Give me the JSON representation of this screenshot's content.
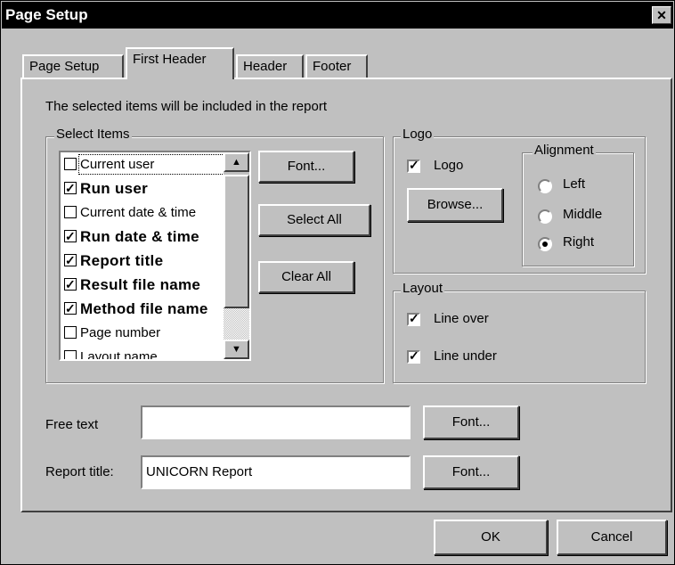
{
  "window": {
    "title": "Page Setup"
  },
  "tabs": [
    {
      "label": "Page Setup"
    },
    {
      "label": "First Header"
    },
    {
      "label": "Header"
    },
    {
      "label": "Footer"
    }
  ],
  "panel": {
    "intro_text": "The selected items will be included in the report",
    "select_items": {
      "group_label": "Select Items",
      "items": [
        {
          "label": "Current user",
          "checked": false,
          "bold": false
        },
        {
          "label": "Run user",
          "checked": true,
          "bold": true
        },
        {
          "label": "Current date & time",
          "checked": false,
          "bold": false
        },
        {
          "label": "Run date & time",
          "checked": true,
          "bold": true
        },
        {
          "label": "Report title",
          "checked": true,
          "bold": true
        },
        {
          "label": "Result file name",
          "checked": true,
          "bold": true
        },
        {
          "label": "Method file name",
          "checked": true,
          "bold": true
        },
        {
          "label": "Page number",
          "checked": false,
          "bold": false
        },
        {
          "label": "Layout name",
          "checked": false,
          "bold": false
        }
      ],
      "font_button": "Font...",
      "select_all_button": "Select All",
      "clear_all_button": "Clear All"
    },
    "logo": {
      "group_label": "Logo",
      "checkbox_label": "Logo",
      "checked": true,
      "browse_button": "Browse...",
      "alignment": {
        "group_label": "Alignment",
        "options": [
          "Left",
          "Middle",
          "Right"
        ],
        "selected": "Right"
      }
    },
    "layout": {
      "group_label": "Layout",
      "line_over_label": "Line over",
      "line_over_checked": true,
      "line_under_label": "Line under",
      "line_under_checked": true
    },
    "free_text": {
      "label": "Free text",
      "value": "",
      "font_button": "Font..."
    },
    "report_title": {
      "label": "Report title:",
      "value": "UNICORN Report",
      "font_button": "Font..."
    }
  },
  "buttons": {
    "ok": "OK",
    "cancel": "Cancel"
  },
  "icons": {
    "close": "close-icon",
    "scroll_up": "scroll-up-arrow-icon",
    "scroll_down": "scroll-down-arrow-icon",
    "check": "checkmark-icon"
  }
}
